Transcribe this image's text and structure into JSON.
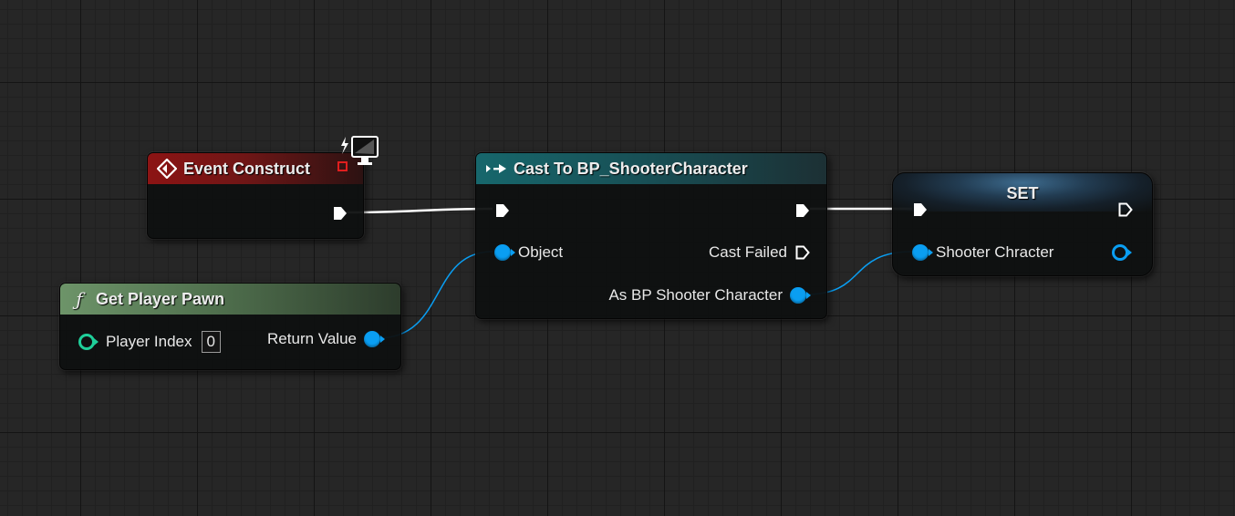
{
  "nodes": {
    "event_construct": {
      "title": "Event Construct"
    },
    "cast": {
      "title": "Cast To BP_ShooterCharacter",
      "object_label": "Object",
      "cast_failed_label": "Cast Failed",
      "as_label": "As BP Shooter Character"
    },
    "set": {
      "title": "SET",
      "var_label": "Shooter Chracter"
    },
    "get_player_pawn": {
      "title": "Get Player Pawn",
      "player_index_label": "Player Index",
      "player_index_value": "0",
      "return_label": "Return Value"
    }
  },
  "colors": {
    "exec_wire": "#ffffff",
    "object_wire": "#0a9ef2",
    "int_pin": "#1fcf9a",
    "event_header": "#8c1414",
    "cast_header": "#17676c",
    "pure_header": "#6d9469"
  },
  "icons": {
    "event": "event-diamond-icon",
    "cast": "cast-arrows-icon",
    "function": "function-f-icon",
    "client_only": "client-monitor-icon",
    "replication": "red-square-icon"
  }
}
